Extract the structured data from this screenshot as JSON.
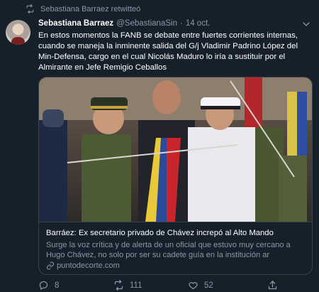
{
  "retweet": {
    "text": "Sebastiana Barraez retwitteó",
    "icon": "retweet-icon"
  },
  "tweet": {
    "author_name": "Sebastiana Barraez",
    "handle": "@SebastianaSin",
    "separator": "·",
    "date": "14 oct.",
    "text": "En estos momentos la FANB se debate entre fuertes corrientes internas, cuando se maneja la inminente salida del G/j Vladimir Padrino López del Min-Defensa, cargo en el cual Nicolás Maduro lo iría a sustituir por el Almirante en Jefe Remigio Ceballos"
  },
  "card": {
    "title": "Barráez: Ex secretario privado de Chávez increpó al Alto Mando",
    "description": "Surge la voz crítica y de alerta de un oficial que estuvo muy cercano a Hugo Chávez, no solo por ser su cadete guía en la institución ar",
    "link": "puntodecorte.com"
  },
  "actions": {
    "replies": "8",
    "retweets": "111",
    "likes": "52"
  },
  "colors": {
    "background": "#15202b",
    "secondary_text": "#8899a6",
    "border": "#38444d"
  }
}
